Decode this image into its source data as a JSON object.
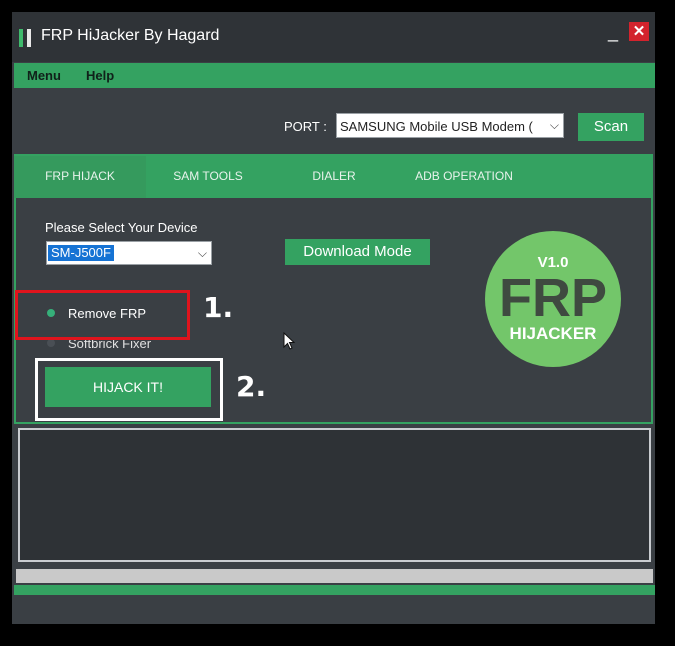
{
  "window": {
    "title": "FRP HiJacker By Hagard",
    "minimize_glyph": "_",
    "close_glyph": "✕"
  },
  "menu": {
    "items": [
      {
        "label": "Menu"
      },
      {
        "label": "Help"
      }
    ]
  },
  "port": {
    "label": "PORT :",
    "selected": "SAMSUNG Mobile USB Modem (",
    "scan_label": "Scan"
  },
  "tabs": [
    {
      "label": "FRP HIJACK",
      "active": true
    },
    {
      "label": "SAM TOOLS",
      "active": false
    },
    {
      "label": "DIALER",
      "active": false
    },
    {
      "label": "ADB OPERATION",
      "active": false
    }
  ],
  "frp_hijack": {
    "device_label": "Please Select Your Device",
    "device_selected": "SM-J500F",
    "download_mode_label": "Download Mode",
    "options": [
      {
        "label": "Remove FRP",
        "checked": true
      },
      {
        "label": "Softbrick Fixer",
        "checked": false
      }
    ],
    "hijack_button_label": "HIJACK IT!"
  },
  "logo": {
    "version": "V1.0",
    "big_text": "FRP",
    "sub_text": "HIJACKER"
  },
  "annotations": {
    "step1": "1.",
    "step2": "2."
  },
  "colors": {
    "accent_green": "#34a261",
    "window_bg": "#3a3f44",
    "annotation_red": "#e0141d",
    "close_red": "#d3232d"
  },
  "icons": {
    "app_logo": "app-logo-icon",
    "dropdown_arrow": "chevron-down-icon",
    "cursor": "mouse-cursor-icon"
  }
}
